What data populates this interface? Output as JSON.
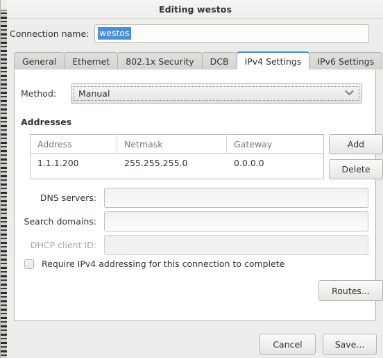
{
  "window": {
    "title": "Editing westos"
  },
  "connection": {
    "label": "Connection name:",
    "value": "westos",
    "placeholder": ""
  },
  "tabs": [
    {
      "label": "General",
      "active": false
    },
    {
      "label": "Ethernet",
      "active": false
    },
    {
      "label": "802.1x Security",
      "active": false
    },
    {
      "label": "DCB",
      "active": false
    },
    {
      "label": "IPv4 Settings",
      "active": true
    },
    {
      "label": "IPv6 Settings",
      "active": false
    }
  ],
  "ipv4": {
    "method": {
      "label": "Method:",
      "value": "Manual",
      "chevron_icon": "chevron-down-icon"
    },
    "addresses_heading": "Addresses",
    "table": {
      "columns": [
        "Address",
        "Netmask",
        "Gateway"
      ],
      "rows": [
        [
          "1.1.1.200",
          "255.255.255.0",
          "0.0.0.0"
        ]
      ]
    },
    "add_label": "Add",
    "delete_label": "Delete",
    "dns": {
      "label": "DNS servers:",
      "value": "",
      "placeholder": ""
    },
    "search": {
      "label": "Search domains:",
      "value": "",
      "placeholder": ""
    },
    "dhcp": {
      "label": "DHCP client ID:",
      "value": "",
      "placeholder": "",
      "disabled": true
    },
    "require_ipv4": {
      "label": "Require IPv4 addressing for this connection to complete",
      "checked": false
    },
    "routes_label": "Routes..."
  },
  "actions": {
    "cancel_label": "Cancel",
    "save_label": "Save..."
  },
  "colors": {
    "accent": "#4a90d9",
    "selection_bg": "#4a90d9",
    "selection_fg": "#ffffff",
    "text": "#2e3436",
    "muted_text": "#7d7a75",
    "disabled_text": "#a9a6a1",
    "dialog_bg": "#ededeb",
    "panel_bg": "#ffffff",
    "border": "#b6b3ae"
  }
}
